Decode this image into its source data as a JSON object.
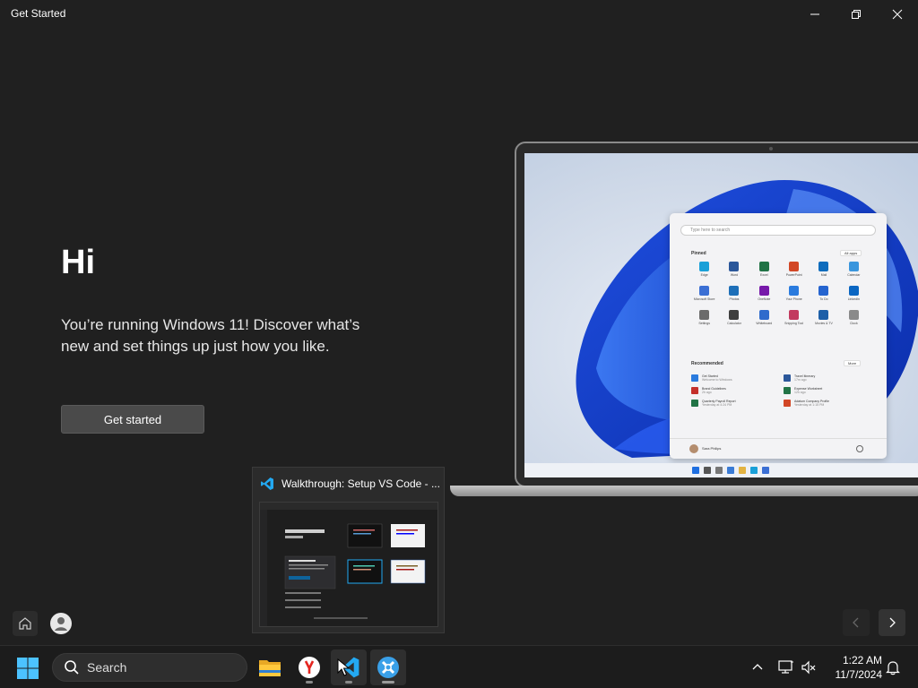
{
  "window": {
    "title": "Get Started"
  },
  "hero": {
    "title": "Hi",
    "text": "You’re running Windows 11! Discover what’s new and set things up just how you like.",
    "button_label": "Get started"
  },
  "laptop_screen": {
    "search_placeholder": "Type here to search",
    "pinned_label": "Pinned",
    "all_apps_label": "All apps",
    "pinned_apps": [
      {
        "label": "Edge",
        "color": "#1aa0d8"
      },
      {
        "label": "Word",
        "color": "#2b579a"
      },
      {
        "label": "Excel",
        "color": "#217346"
      },
      {
        "label": "PowerPoint",
        "color": "#d24726"
      },
      {
        "label": "Mail",
        "color": "#0f6cbd"
      },
      {
        "label": "Calendar",
        "color": "#3a96dd"
      },
      {
        "label": "Microsoft Store",
        "color": "#3b6fd4"
      },
      {
        "label": "Photos",
        "color": "#1e6fb8"
      },
      {
        "label": "OneNote",
        "color": "#7719aa"
      },
      {
        "label": "Your Phone",
        "color": "#2a7bde"
      },
      {
        "label": "To Do",
        "color": "#2564cf"
      },
      {
        "label": "LinkedIn",
        "color": "#0a66c2"
      },
      {
        "label": "Settings",
        "color": "#6b6b6b"
      },
      {
        "label": "Calculator",
        "color": "#3f3f3f"
      },
      {
        "label": "Whiteboard",
        "color": "#2f6bcc"
      },
      {
        "label": "Snipping Tool",
        "color": "#c23a5f"
      },
      {
        "label": "Movies & TV",
        "color": "#1d5fa8"
      },
      {
        "label": "Clock",
        "color": "#8a8a8a"
      }
    ],
    "recommended_label": "Recommended",
    "more_label": "More",
    "recommended": [
      {
        "label": "Get Started",
        "sub": "Welcome to Windows",
        "color": "#2a7bde"
      },
      {
        "label": "Travel Itinerary",
        "sub": "17m ago",
        "color": "#2b579a"
      },
      {
        "label": "Brand Guidelines",
        "sub": "2h ago",
        "color": "#c4302b"
      },
      {
        "label": "Expense Worksheet",
        "sub": "12h ago",
        "color": "#217346"
      },
      {
        "label": "Quarterly Payroll Report",
        "sub": "Yesterday at 4:24 PM",
        "color": "#217346"
      },
      {
        "label": "Adatum Company Profile",
        "sub": "Yesterday at 1:15 PM",
        "color": "#d24726"
      }
    ],
    "user_name": "Sara Philips"
  },
  "preview": {
    "title": "Walkthrough: Setup VS Code - ..."
  },
  "taskbar": {
    "search_label": "Search",
    "time": "1:22 AM",
    "date": "11/7/2024"
  },
  "colors": {
    "background": "#202020",
    "accent": "#0078d4",
    "vscode_blue": "#23a9f2"
  }
}
